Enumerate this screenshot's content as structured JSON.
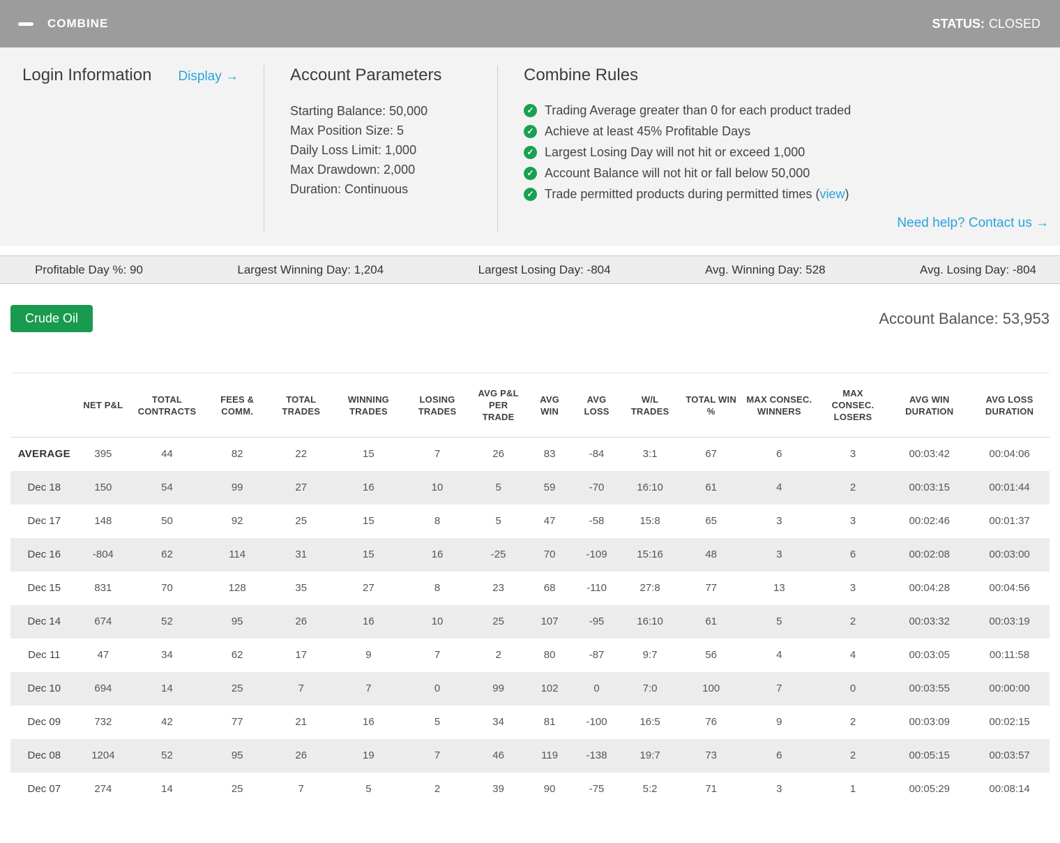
{
  "topbar": {
    "title": "COMBINE",
    "status_label": "STATUS:",
    "status_value": "CLOSED"
  },
  "panel": {
    "login": {
      "title": "Login Information",
      "display_link": "Display →"
    },
    "account_parameters": {
      "title": "Account Parameters",
      "lines": [
        "Starting Balance: 50,000",
        "Max Position Size: 5",
        "Daily Loss Limit: 1,000",
        "Max Drawdown: 2,000",
        "Duration: Continuous"
      ]
    },
    "combine_rules": {
      "title": "Combine Rules",
      "items": [
        "Trading Average greater than 0 for each product traded",
        "Achieve at least 45% Profitable Days",
        "Largest Losing Day will not hit or exceed 1,000",
        "Account Balance will not hit or fall below 50,000"
      ],
      "rule5_prefix": "Trade permitted products during permitted times (",
      "rule5_link": "view",
      "rule5_suffix": ")",
      "help_link": "Need help? Contact us →"
    }
  },
  "stats_bar": [
    "Profitable Day %: 90",
    "Largest Winning Day: 1,204",
    "Largest Losing Day: -804",
    "Avg. Winning Day: 528",
    "Avg. Losing Day: -804"
  ],
  "account": {
    "product_button": "Crude Oil",
    "balance_text": "Account Balance: 53,953"
  },
  "table": {
    "headers": [
      "",
      "NET P&L",
      "TOTAL CONTRACTS",
      "FEES & COMM.",
      "TOTAL TRADES",
      "WINNING TRADES",
      "LOSING TRADES",
      "AVG P&L PER TRADE",
      "AVG WIN",
      "AVG LOSS",
      "W/L TRADES",
      "TOTAL WIN %",
      "MAX CONSEC. WINNERS",
      "MAX CONSEC. LOSERS",
      "AVG WIN DURATION",
      "AVG LOSS DURATION"
    ],
    "rows": [
      {
        "label": "AVERAGE",
        "cells": [
          "395",
          "44",
          "82",
          "22",
          "15",
          "7",
          "26",
          "83",
          "-84",
          "3:1",
          "67",
          "6",
          "3",
          "00:03:42",
          "00:04:06"
        ]
      },
      {
        "label": "Dec 18",
        "cells": [
          "150",
          "54",
          "99",
          "27",
          "16",
          "10",
          "5",
          "59",
          "-70",
          "16:10",
          "61",
          "4",
          "2",
          "00:03:15",
          "00:01:44"
        ]
      },
      {
        "label": "Dec 17",
        "cells": [
          "148",
          "50",
          "92",
          "25",
          "15",
          "8",
          "5",
          "47",
          "-58",
          "15:8",
          "65",
          "3",
          "3",
          "00:02:46",
          "00:01:37"
        ]
      },
      {
        "label": "Dec 16",
        "cells": [
          "-804",
          "62",
          "114",
          "31",
          "15",
          "16",
          "-25",
          "70",
          "-109",
          "15:16",
          "48",
          "3",
          "6",
          "00:02:08",
          "00:03:00"
        ]
      },
      {
        "label": "Dec 15",
        "cells": [
          "831",
          "70",
          "128",
          "35",
          "27",
          "8",
          "23",
          "68",
          "-110",
          "27:8",
          "77",
          "13",
          "3",
          "00:04:28",
          "00:04:56"
        ]
      },
      {
        "label": "Dec 14",
        "cells": [
          "674",
          "52",
          "95",
          "26",
          "16",
          "10",
          "25",
          "107",
          "-95",
          "16:10",
          "61",
          "5",
          "2",
          "00:03:32",
          "00:03:19"
        ]
      },
      {
        "label": "Dec 11",
        "cells": [
          "47",
          "34",
          "62",
          "17",
          "9",
          "7",
          "2",
          "80",
          "-87",
          "9:7",
          "56",
          "4",
          "4",
          "00:03:05",
          "00:11:58"
        ]
      },
      {
        "label": "Dec 10",
        "cells": [
          "694",
          "14",
          "25",
          "7",
          "7",
          "0",
          "99",
          "102",
          "0",
          "7:0",
          "100",
          "7",
          "0",
          "00:03:55",
          "00:00:00"
        ]
      },
      {
        "label": "Dec 09",
        "cells": [
          "732",
          "42",
          "77",
          "21",
          "16",
          "5",
          "34",
          "81",
          "-100",
          "16:5",
          "76",
          "9",
          "2",
          "00:03:09",
          "00:02:15"
        ]
      },
      {
        "label": "Dec 08",
        "cells": [
          "1204",
          "52",
          "95",
          "26",
          "19",
          "7",
          "46",
          "119",
          "-138",
          "19:7",
          "73",
          "6",
          "2",
          "00:05:15",
          "00:03:57"
        ]
      },
      {
        "label": "Dec 07",
        "cells": [
          "274",
          "14",
          "25",
          "7",
          "5",
          "2",
          "39",
          "90",
          "-75",
          "5:2",
          "71",
          "3",
          "1",
          "00:05:29",
          "00:08:14"
        ]
      }
    ]
  },
  "colors": {
    "accent_blue": "#29a3dd",
    "green": "#189a4f",
    "topbar_gray": "#9c9c9c"
  }
}
